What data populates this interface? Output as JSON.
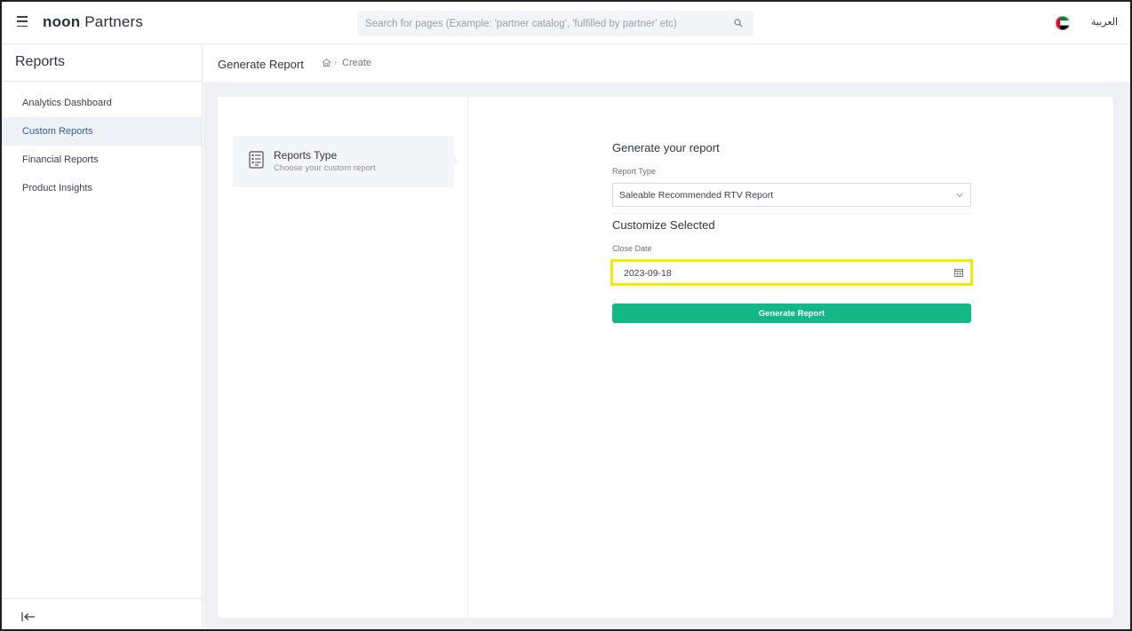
{
  "header": {
    "logo_bold": "noon",
    "logo_rest": " Partners",
    "search_placeholder": "Search for pages (Example: 'partner catalog', 'fulfilled by partner' etc)",
    "language_label": "العربية",
    "flag": "uae-flag-icon"
  },
  "sidebar": {
    "title": "Reports",
    "items": [
      {
        "label": "Analytics Dashboard",
        "active": false
      },
      {
        "label": "Custom Reports",
        "active": true
      },
      {
        "label": "Financial Reports",
        "active": false
      },
      {
        "label": "Product Insights",
        "active": false
      }
    ],
    "collapse_icon": "collapse-left-icon"
  },
  "breadcrumb": {
    "title": "Generate Report",
    "separator": "›",
    "current": "Create"
  },
  "steps": [
    {
      "title": "Reports Type",
      "subtitle": "Choose your custom report",
      "icon": "report-document-icon"
    }
  ],
  "form": {
    "heading": "Generate your report",
    "report_type_label": "Report Type",
    "report_type_value": "Saleable Recommended RTV Report",
    "customize_heading": "Customize Selected",
    "close_date_label": "Close Date",
    "close_date_value": "2023-09-18",
    "submit_label": "Generate Report"
  },
  "colors": {
    "accent_green": "#14b886",
    "active_nav": "#2f5d93",
    "highlight": "#f4ec00"
  }
}
